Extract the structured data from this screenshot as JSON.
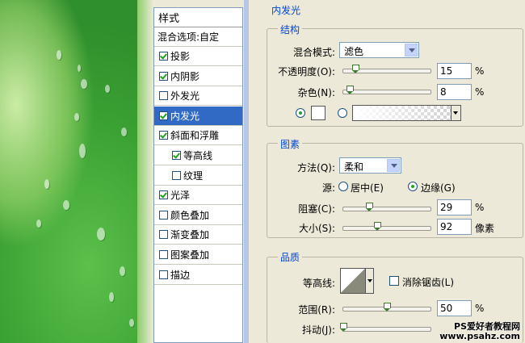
{
  "style_list": {
    "header": "样式",
    "blending_options": "混合选项:自定",
    "items": [
      {
        "label": "投影",
        "checked": true
      },
      {
        "label": "内阴影",
        "checked": true
      },
      {
        "label": "外发光",
        "checked": false
      },
      {
        "label": "内发光",
        "checked": true,
        "selected": true
      },
      {
        "label": "斜面和浮雕",
        "checked": true
      },
      {
        "label": "等高线",
        "checked": true,
        "sub": true
      },
      {
        "label": "纹理",
        "checked": false,
        "sub": true
      },
      {
        "label": "光泽",
        "checked": true
      },
      {
        "label": "颜色叠加",
        "checked": false
      },
      {
        "label": "渐变叠加",
        "checked": false
      },
      {
        "label": "图案叠加",
        "checked": false
      },
      {
        "label": "描边",
        "checked": false
      }
    ]
  },
  "panel": {
    "title": "内发光",
    "structure": {
      "title": "结构",
      "blend_mode_label": "混合模式:",
      "blend_mode_value": "滤色",
      "opacity_label": "不透明度(O):",
      "opacity_value": "15",
      "opacity_unit": "%",
      "noise_label": "杂色(N):",
      "noise_value": "8",
      "noise_unit": "%"
    },
    "elements": {
      "title": "图素",
      "method_label": "方法(Q):",
      "method_value": "柔和",
      "source_label": "源:",
      "source_center": "居中(E)",
      "source_edge": "边缘(G)",
      "source_selected": "edge",
      "choke_label": "阻塞(C):",
      "choke_value": "29",
      "choke_unit": "%",
      "size_label": "大小(S):",
      "size_value": "92",
      "size_unit": "像素"
    },
    "quality": {
      "title": "品质",
      "contour_label": "等高线:",
      "antialias_label": "消除锯齿(L)",
      "antialias_checked": false,
      "range_label": "范围(R):",
      "range_value": "50",
      "range_unit": "%",
      "jitter_label": "抖动(J):"
    }
  },
  "watermark": {
    "line1": "PS爱好者教程网",
    "line2": "www.psahz.com"
  }
}
